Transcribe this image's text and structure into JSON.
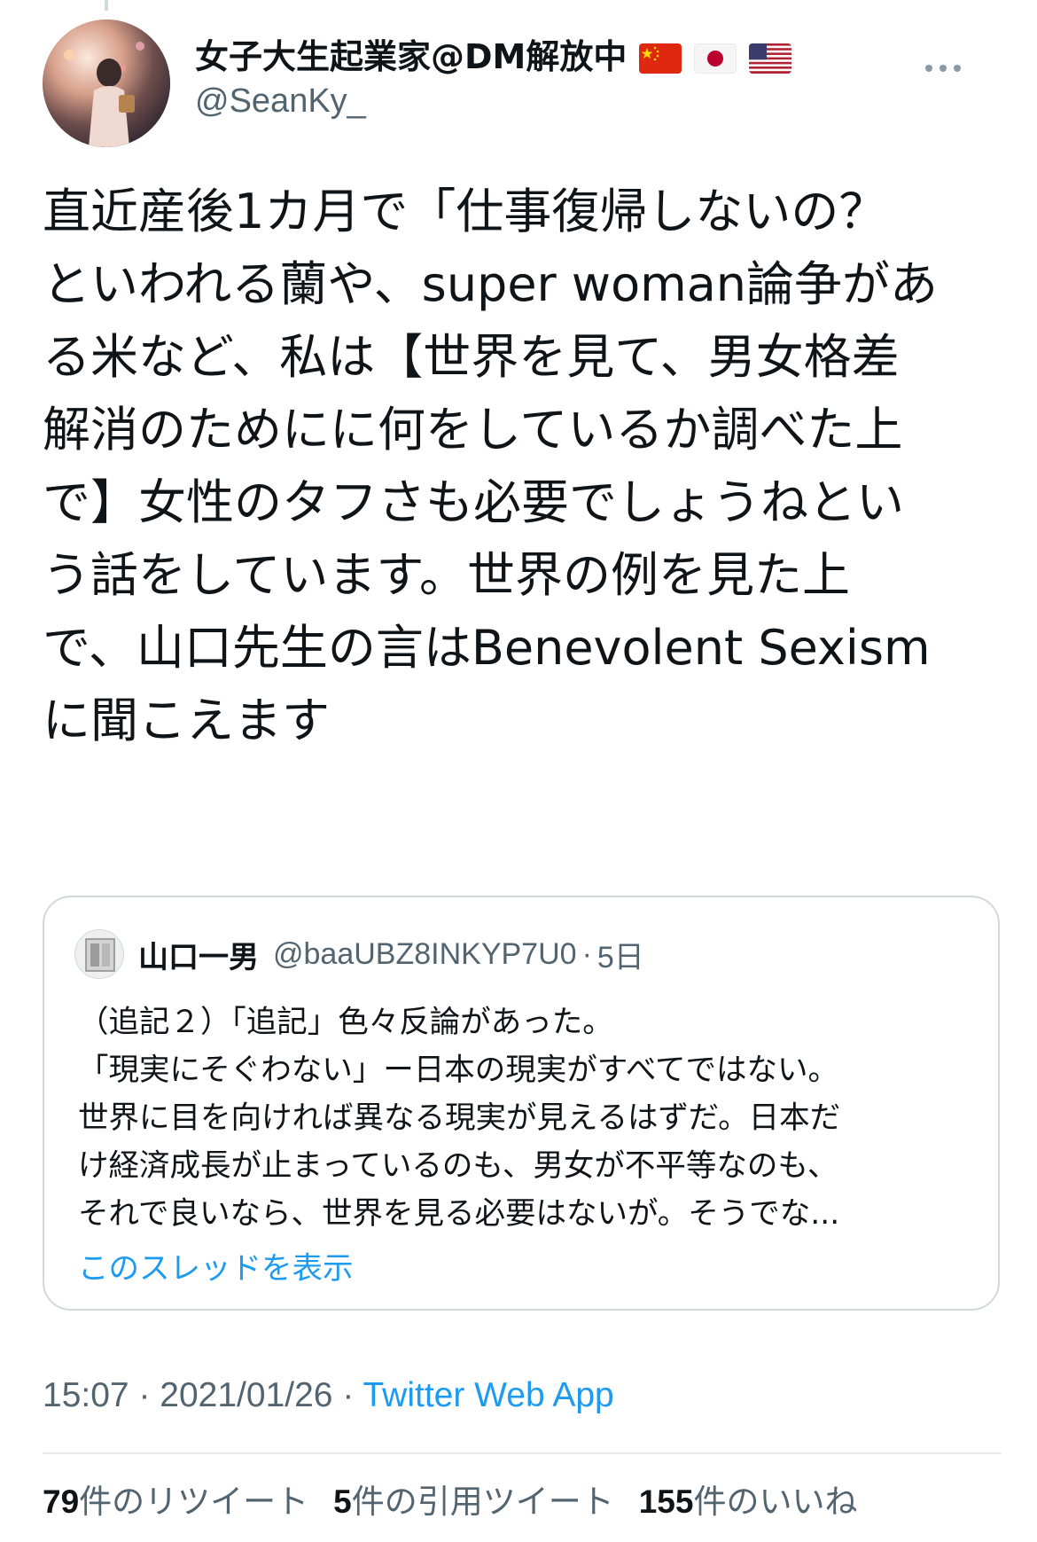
{
  "user": {
    "display_name": "女子大生起業家@DM解放中",
    "handle": "@SeanKy_",
    "flags": [
      "china-flag-icon",
      "japan-flag-icon",
      "usa-flag-icon"
    ]
  },
  "tweet": {
    "lines": [
      "直近産後1カ月で「仕事復帰しないの？",
      "といわれる蘭や、super woman論争があ",
      "る米など、私は【世界を見て、男女格差",
      "解消のためにに何をしているか調べた上",
      "で】女性のタフさも必要でしょうねとい",
      "う話をしています。世界の例を見た上",
      "で、山口先生の言はBenevolent Sexism",
      "に聞こえます"
    ]
  },
  "quote": {
    "name": "山口一男",
    "handle": "@baaUBZ8INKYP7U0",
    "separator": "·",
    "time": "5日",
    "lines": [
      "（追記２）「追記」色々反論があった。",
      "「現実にそぐわない」ー日本の現実がすべてではない。",
      "世界に目を向ければ異なる現実が見えるはずだ。日本だ",
      "け経済成長が止まっているのも、男女が不平等なのも、",
      "それで良いなら、世界を見る必要はないが。そうでな..."
    ],
    "show_thread": "このスレッドを表示"
  },
  "meta": {
    "time": "15:07",
    "separator": "·",
    "date": "2021/01/26",
    "source": "Twitter Web App"
  },
  "stats": {
    "retweets_count": "79",
    "retweets_label": "件のリツイート",
    "quotes_count": "5",
    "quotes_label": "件の引用ツイート",
    "likes_count": "155",
    "likes_label": "件のいいね"
  },
  "colors": {
    "text": "#0f1419",
    "secondary": "#536471",
    "link": "#1d9bf0",
    "border": "#cfd9de"
  }
}
